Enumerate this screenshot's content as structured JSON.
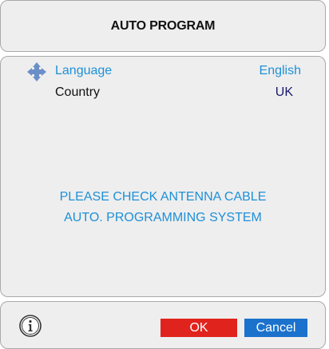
{
  "header": {
    "title": "AUTO PROGRAM"
  },
  "settings": [
    {
      "label": "Language",
      "value": "English",
      "icon": "move-arrows-icon"
    },
    {
      "label": "Country",
      "value": "UK"
    }
  ],
  "message": {
    "line1": "PLEASE CHECK ANTENNA CABLE",
    "line2": "AUTO. PROGRAMMING SYSTEM"
  },
  "footer": {
    "info_icon": "info-icon",
    "ok_label": "OK",
    "cancel_label": "Cancel"
  },
  "colors": {
    "highlight_text": "#1e90d8",
    "ok_button": "#e0231c",
    "cancel_button": "#1a72cc",
    "panel_background": "#eeeeee"
  }
}
